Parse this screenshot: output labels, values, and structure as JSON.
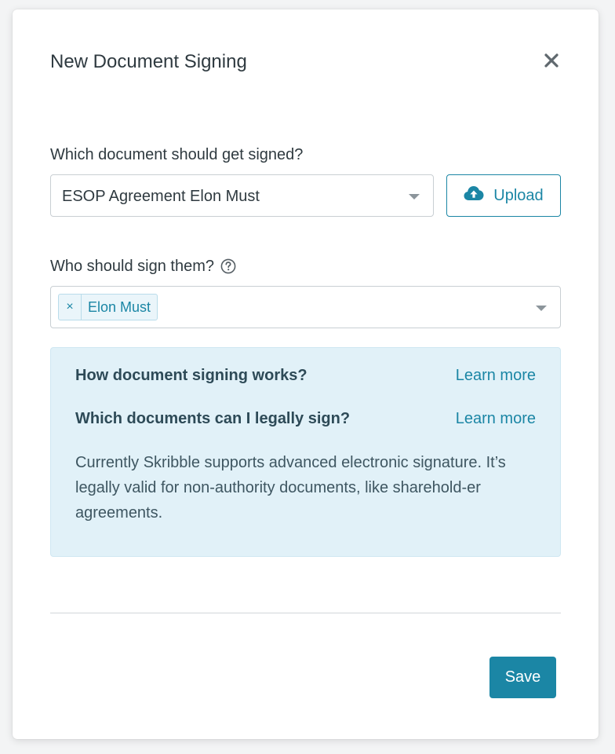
{
  "modal": {
    "title": "New Document Signing",
    "close_icon": "close-icon"
  },
  "document_field": {
    "label": "Which document should get signed?",
    "selected_value": "ESOP Agreement Elon Must",
    "upload_label": "Upload",
    "upload_icon": "cloud-upload-icon"
  },
  "signers_field": {
    "label": "Who should sign them?",
    "help_icon": "question-circle-icon",
    "tags": [
      {
        "label": "Elon Must",
        "remove": "×"
      }
    ]
  },
  "info": {
    "rows": [
      {
        "question": "How document signing works?",
        "link": "Learn more"
      },
      {
        "question": "Which documents can I legally sign?",
        "link": "Learn more"
      }
    ],
    "text": "Currently Skribble supports advanced electronic signature. It’s legally valid for non-authority documents, like sharehold-er agreements."
  },
  "footer": {
    "save_label": "Save"
  },
  "colors": {
    "accent": "#1b86a5",
    "info_background": "#e1f1f8",
    "text": "#2f3a40"
  }
}
